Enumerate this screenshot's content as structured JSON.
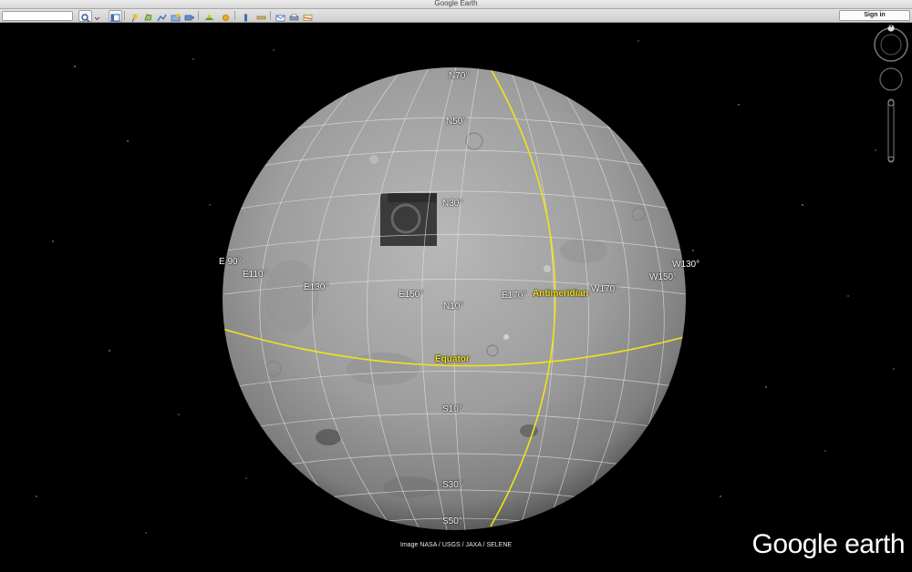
{
  "window": {
    "title": "Google Earth"
  },
  "toolbar": {
    "search_value": "",
    "signin_label": "Sign in"
  },
  "map": {
    "latitude_labels": [
      "N70°",
      "N50°",
      "N30°",
      "N10°",
      "S10°",
      "S30°",
      "S50°"
    ],
    "longitude_labels": [
      "E 90°",
      "E110°",
      "E130°",
      "E150°",
      "E170°",
      "W170°",
      "W150°",
      "W130°"
    ],
    "equator_label": "Equator",
    "antimeridian_label": "Antimeridian",
    "attribution": "Image NASA / USGS / JAXA / SELENE",
    "compass_north": "N",
    "logo_text": "Google earth",
    "colors": {
      "grid_special": "#f2e21a",
      "grid": "#e6e6e6",
      "space": "#000000"
    }
  }
}
